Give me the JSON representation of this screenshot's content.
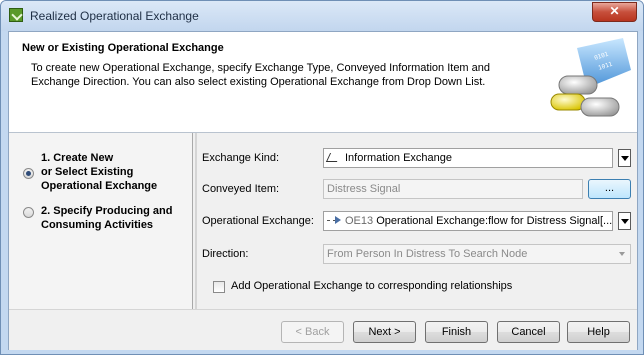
{
  "window": {
    "title": "Realized Operational Exchange",
    "close_label": "✕"
  },
  "header": {
    "title": "New or Existing Operational Exchange",
    "description": "To create new Operational Exchange, specify Exchange Type, Conveyed Information Item and Exchange Direction. You can also select existing Operational Exchange from Drop Down List."
  },
  "steps": [
    {
      "label": "1. Create New\nor Select Existing\nOperational Exchange",
      "selected": true
    },
    {
      "label": "2. Specify Producing and\nConsuming Activities",
      "selected": false
    }
  ],
  "form": {
    "exchange_kind": {
      "label": "Exchange Kind:",
      "value": "Information Exchange"
    },
    "conveyed_item": {
      "label": "Conveyed Item:",
      "value": "Distress Signal",
      "browse_label": "..."
    },
    "operational_exchange": {
      "label": "Operational Exchange:",
      "id": "OE13",
      "value": "Operational Exchange:flow for Distress Signal[..."
    },
    "direction": {
      "label": "Direction:",
      "value": "From Person In Distress To Search Node"
    },
    "add_checkbox": {
      "label": "Add Operational Exchange to corresponding relationships",
      "checked": false
    }
  },
  "buttons": {
    "back": "< Back",
    "next": "Next >",
    "finish": "Finish",
    "cancel": "Cancel",
    "help": "Help"
  }
}
